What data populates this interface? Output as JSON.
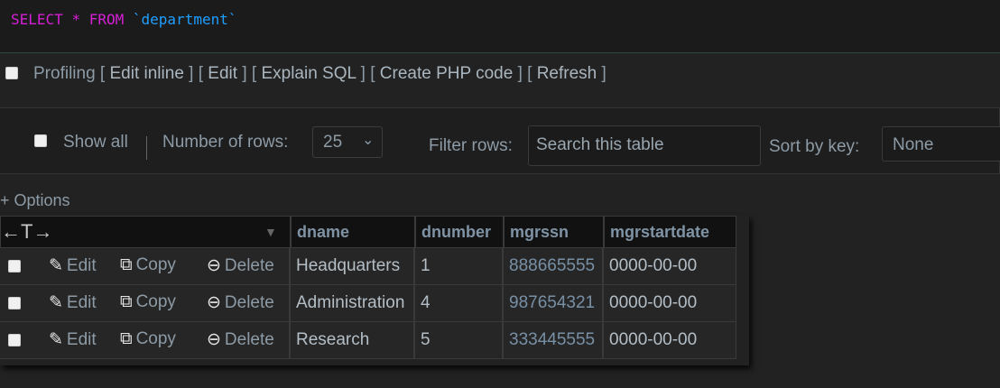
{
  "sql": {
    "select_kw": "SELECT",
    "star": "*",
    "from_kw": "FROM",
    "table": "`department`"
  },
  "links": {
    "profiling": "Profiling",
    "edit_inline": "Edit inline",
    "edit": "Edit",
    "explain_sql": "Explain SQL",
    "create_php": "Create PHP code",
    "refresh": "Refresh"
  },
  "controls": {
    "show_all": "Show all",
    "number_of_rows_label": "Number of rows:",
    "number_of_rows_value": "25",
    "filter_rows_label": "Filter rows:",
    "filter_placeholder": "Search this table",
    "sort_by_key_label": "Sort by key:",
    "sort_by_key_value": "None"
  },
  "options_label": "+ Options",
  "table": {
    "arrows": "←T→",
    "columns": [
      "dname",
      "dnumber",
      "mgrssn",
      "mgrstartdate"
    ],
    "actions": {
      "edit": "Edit",
      "copy": "Copy",
      "delete": "Delete"
    },
    "rows": [
      {
        "dname": "Headquarters",
        "dnumber": "1",
        "mgrssn": "888665555",
        "mgrstartdate": "0000-00-00"
      },
      {
        "dname": "Administration",
        "dnumber": "4",
        "mgrssn": "987654321",
        "mgrstartdate": "0000-00-00"
      },
      {
        "dname": "Research",
        "dnumber": "5",
        "mgrssn": "333445555",
        "mgrstartdate": "0000-00-00"
      }
    ]
  },
  "colors": {
    "sql_keyword": "#d61fd6",
    "sql_table": "#1f9fff",
    "background": "#222222",
    "link_text": "#8d9ba6"
  }
}
